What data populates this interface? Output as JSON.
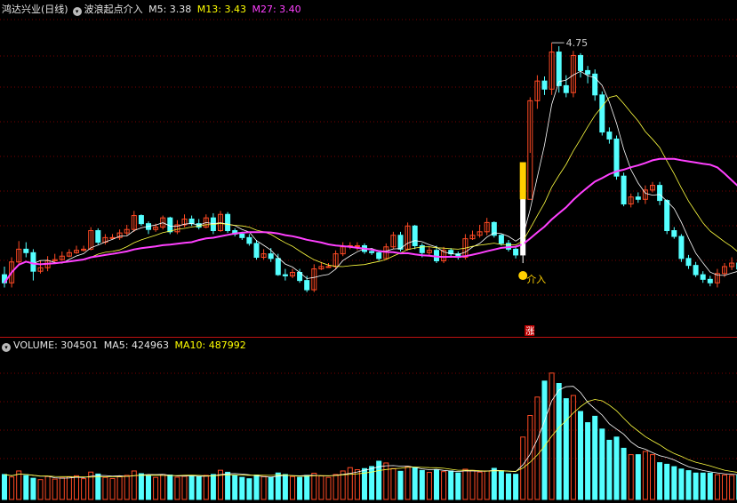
{
  "header": {
    "stock_title": "鸿达兴业(日线)",
    "indicator_name": "波浪起点介入",
    "m5": "M5: 3.38",
    "m13": "M13: 3.43",
    "m27": "M27: 3.40"
  },
  "volume_header": {
    "volume": "VOLUME: 304501",
    "ma5": "MA5: 424963",
    "ma10": "MA10: 487992"
  },
  "colors": {
    "up": "#ff4a24",
    "down": "#54ffff",
    "m5": "#ffffff",
    "m13": "#ffff40",
    "m27": "#ff40ff",
    "signal": "#ffd000",
    "grid": "#7a0000"
  },
  "chart_data": [
    {
      "type": "candlestick",
      "price_range": [
        2.36,
        4.95
      ],
      "annotations": {
        "high_label": "4.75",
        "signal_label": "介入",
        "limit_up_badge": "涨"
      },
      "signal_index": 72,
      "ohlc": [
        [
          2.75,
          2.68,
          2.82,
          2.64
        ],
        [
          2.68,
          2.86,
          2.9,
          2.64
        ],
        [
          2.86,
          2.97,
          3.04,
          2.84
        ],
        [
          2.97,
          2.94,
          3.03,
          2.9
        ],
        [
          2.94,
          2.78,
          2.97,
          2.7
        ],
        [
          2.78,
          2.81,
          2.87,
          2.76
        ],
        [
          2.81,
          2.87,
          2.91,
          2.78
        ],
        [
          2.87,
          2.88,
          2.93,
          2.86
        ],
        [
          2.88,
          2.91,
          2.95,
          2.87
        ],
        [
          2.91,
          2.94,
          2.97,
          2.9
        ],
        [
          2.94,
          2.96,
          3.0,
          2.93
        ],
        [
          2.96,
          2.97,
          3.0,
          2.95
        ],
        [
          2.97,
          3.13,
          3.16,
          2.96
        ],
        [
          3.13,
          3.03,
          3.15,
          3.01
        ],
        [
          3.03,
          3.07,
          3.1,
          3.01
        ],
        [
          3.07,
          3.07,
          3.1,
          3.06
        ],
        [
          3.07,
          3.11,
          3.14,
          3.05
        ],
        [
          3.11,
          3.14,
          3.18,
          3.09
        ],
        [
          3.14,
          3.26,
          3.3,
          3.12
        ],
        [
          3.26,
          3.19,
          3.27,
          3.17
        ],
        [
          3.19,
          3.14,
          3.21,
          3.1
        ],
        [
          3.14,
          3.16,
          3.19,
          3.12
        ],
        [
          3.16,
          3.24,
          3.26,
          3.14
        ],
        [
          3.24,
          3.12,
          3.25,
          3.1
        ],
        [
          3.12,
          3.18,
          3.22,
          3.1
        ],
        [
          3.18,
          3.23,
          3.27,
          3.16
        ],
        [
          3.23,
          3.19,
          3.26,
          3.17
        ],
        [
          3.19,
          3.16,
          3.23,
          3.14
        ],
        [
          3.16,
          3.24,
          3.27,
          3.15
        ],
        [
          3.24,
          3.13,
          3.28,
          3.1
        ],
        [
          3.13,
          3.27,
          3.3,
          3.12
        ],
        [
          3.27,
          3.13,
          3.29,
          3.11
        ],
        [
          3.13,
          3.1,
          3.15,
          3.08
        ],
        [
          3.1,
          3.07,
          3.12,
          3.05
        ],
        [
          3.07,
          3.02,
          3.1,
          3.0
        ],
        [
          3.02,
          2.9,
          3.05,
          2.88
        ],
        [
          2.9,
          2.93,
          2.97,
          2.88
        ],
        [
          2.93,
          2.89,
          2.98,
          2.86
        ],
        [
          2.89,
          2.75,
          2.93,
          2.74
        ],
        [
          2.75,
          2.74,
          2.8,
          2.7
        ],
        [
          2.74,
          2.77,
          2.8,
          2.72
        ],
        [
          2.77,
          2.7,
          2.8,
          2.68
        ],
        [
          2.7,
          2.62,
          2.74,
          2.6
        ],
        [
          2.62,
          2.8,
          2.84,
          2.6
        ],
        [
          2.8,
          2.82,
          2.86,
          2.79
        ],
        [
          2.82,
          2.82,
          2.85,
          2.81
        ],
        [
          2.82,
          2.93,
          2.96,
          2.8
        ],
        [
          2.93,
          2.99,
          3.03,
          2.91
        ],
        [
          2.99,
          3.0,
          3.03,
          2.97
        ],
        [
          3.0,
          3.0,
          3.03,
          2.96
        ],
        [
          3.0,
          2.95,
          3.02,
          2.93
        ],
        [
          2.95,
          2.94,
          2.98,
          2.92
        ],
        [
          2.94,
          2.89,
          2.96,
          2.87
        ],
        [
          2.89,
          2.99,
          3.02,
          2.88
        ],
        [
          2.99,
          3.09,
          3.12,
          2.97
        ],
        [
          3.09,
          2.97,
          3.12,
          2.95
        ],
        [
          2.97,
          3.17,
          3.2,
          2.96
        ],
        [
          3.17,
          3.0,
          3.18,
          2.97
        ],
        [
          3.0,
          2.94,
          3.02,
          2.9
        ],
        [
          2.94,
          2.96,
          2.99,
          2.92
        ],
        [
          2.96,
          2.87,
          3.0,
          2.85
        ],
        [
          2.87,
          2.96,
          2.99,
          2.85
        ],
        [
          2.96,
          2.93,
          2.98,
          2.91
        ],
        [
          2.93,
          2.9,
          2.95,
          2.88
        ],
        [
          2.9,
          3.06,
          3.1,
          2.88
        ],
        [
          3.06,
          3.09,
          3.13,
          3.05
        ],
        [
          3.09,
          3.12,
          3.18,
          3.07
        ],
        [
          3.12,
          3.2,
          3.24,
          3.09
        ],
        [
          3.2,
          3.09,
          3.21,
          3.07
        ],
        [
          3.09,
          3.02,
          3.1,
          3.0
        ],
        [
          3.02,
          2.97,
          3.05,
          2.95
        ],
        [
          2.97,
          2.92,
          3.0,
          2.89
        ],
        [
          2.92,
          3.4,
          3.42,
          2.85
        ],
        [
          3.4,
          4.25,
          4.28,
          3.8
        ],
        [
          4.25,
          4.42,
          4.47,
          4.18
        ],
        [
          4.42,
          4.35,
          4.46,
          4.3
        ],
        [
          4.35,
          4.67,
          4.75,
          4.3
        ],
        [
          4.67,
          4.38,
          4.72,
          4.32
        ],
        [
          4.38,
          4.32,
          4.47,
          4.28
        ],
        [
          4.32,
          4.64,
          4.68,
          4.28
        ],
        [
          4.64,
          4.51,
          4.66,
          4.45
        ],
        [
          4.51,
          4.48,
          4.55,
          4.4
        ],
        [
          4.48,
          4.3,
          4.52,
          4.25
        ],
        [
          4.3,
          3.98,
          4.33,
          3.95
        ],
        [
          3.98,
          3.92,
          4.02,
          3.88
        ],
        [
          3.92,
          3.6,
          3.95,
          3.57
        ],
        [
          3.6,
          3.36,
          3.63,
          3.34
        ],
        [
          3.36,
          3.42,
          3.45,
          3.33
        ],
        [
          3.42,
          3.4,
          3.46,
          3.37
        ],
        [
          3.4,
          3.48,
          3.52,
          3.36
        ],
        [
          3.48,
          3.52,
          3.55,
          3.46
        ],
        [
          3.52,
          3.39,
          3.55,
          3.35
        ],
        [
          3.39,
          3.13,
          3.4,
          3.1
        ],
        [
          3.13,
          3.08,
          3.16,
          3.06
        ],
        [
          3.08,
          2.89,
          3.1,
          2.86
        ],
        [
          2.89,
          2.83,
          2.92,
          2.8
        ],
        [
          2.83,
          2.75,
          2.86,
          2.73
        ],
        [
          2.75,
          2.71,
          2.78,
          2.68
        ],
        [
          2.71,
          2.68,
          2.74,
          2.65
        ],
        [
          2.68,
          2.76,
          2.8,
          2.64
        ],
        [
          2.76,
          2.82,
          2.85,
          2.73
        ],
        [
          2.82,
          2.85,
          2.9,
          2.79
        ],
        [
          2.85,
          2.8,
          2.88,
          2.77
        ]
      ],
      "series_colors": {
        "up": "#ff4a24",
        "down": "#54ffff"
      }
    },
    {
      "type": "bar",
      "volume_range": [
        0,
        1800000
      ],
      "values": [
        312000,
        281000,
        356000,
        298000,
        265000,
        248000,
        287000,
        255000,
        270000,
        283000,
        296000,
        260000,
        342000,
        318000,
        276000,
        262000,
        284000,
        301000,
        356000,
        322000,
        298000,
        276000,
        312000,
        305000,
        278000,
        289000,
        296000,
        284000,
        301000,
        312000,
        365000,
        340000,
        298000,
        276000,
        259000,
        305000,
        286000,
        274000,
        331000,
        312000,
        287000,
        276000,
        301000,
        328000,
        294000,
        276000,
        312000,
        356000,
        398000,
        372000,
        386000,
        412000,
        478000,
        456000,
        386000,
        352000,
        412000,
        398000,
        362000,
        338000,
        372000,
        348000,
        356000,
        331000,
        378000,
        362000,
        342000,
        356000,
        389000,
        358000,
        320000,
        315000,
        780000,
        1050000,
        1280000,
        1480000,
        1580000,
        1450000,
        1260000,
        1300000,
        1100000,
        960000,
        1040000,
        880000,
        740000,
        780000,
        640000,
        560000,
        560000,
        600000,
        560000,
        460000,
        440000,
        410000,
        380000,
        360000,
        330000,
        330000,
        330000,
        310000,
        305000,
        300000,
        304501
      ],
      "series_colors": {
        "up": "#ff4a24",
        "down": "#54ffff"
      }
    }
  ]
}
